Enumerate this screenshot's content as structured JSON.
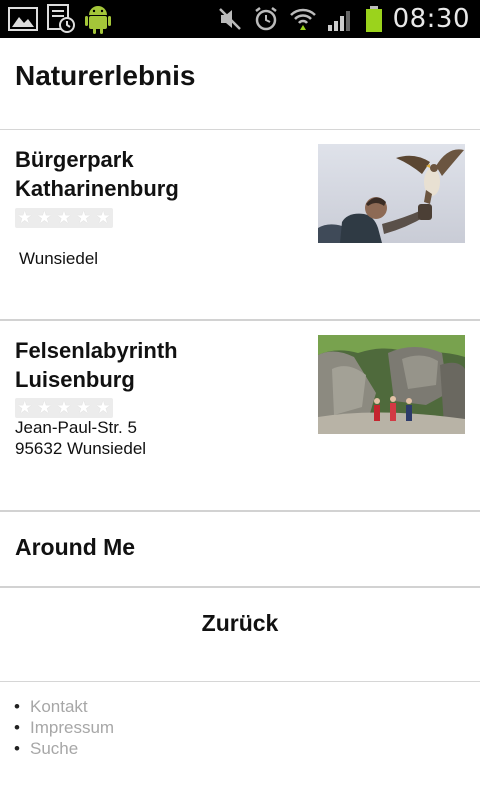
{
  "status_bar": {
    "time": "08:30",
    "icons": [
      "gallery-icon",
      "calendar-clock-icon",
      "android-icon",
      "mute-icon",
      "alarm-icon",
      "wifi-icon",
      "signal-icon",
      "battery-icon"
    ]
  },
  "page": {
    "title": "Naturerlebnis"
  },
  "places": [
    {
      "name": "Bürgerpark Katharinenburg",
      "address_line1": "Wunsiedel",
      "address_line2": "",
      "image": "falconer-with-hawk-photo",
      "rating": 0
    },
    {
      "name": "Felsenlabyrinth Luisenburg",
      "address_line1": "Jean-Paul-Str. 5",
      "address_line2": "95632 Wunsiedel",
      "image": "rock-labyrinth-photo",
      "rating": 0
    }
  ],
  "nav": {
    "around_me": "Around Me",
    "back": "Zurück"
  },
  "footer": {
    "links": [
      "Kontakt",
      "Impressum",
      "Suche"
    ]
  },
  "colors": {
    "status_bar": "#000000",
    "footer_link": "#a7a7a7",
    "divider": "#d2d2d2",
    "battery": "#9bd31c"
  }
}
